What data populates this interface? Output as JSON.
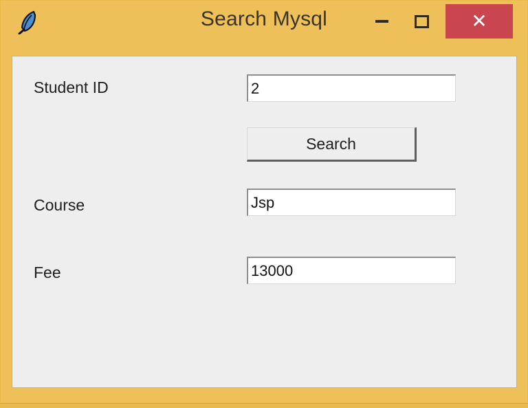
{
  "window": {
    "title": "Search Mysql",
    "icon": "feather-icon",
    "frame_color": "#edc05a",
    "client_color": "#efeeee",
    "controls": {
      "minimize_label": "–",
      "maximize_label": "□",
      "close_label": "✕",
      "close_color": "#c9464f"
    }
  },
  "form": {
    "fields": [
      {
        "label": "Student ID",
        "value": "2",
        "placeholder": ""
      },
      {
        "label": "Course",
        "value": "Jsp",
        "placeholder": ""
      },
      {
        "label": "Fee",
        "value": "13000",
        "placeholder": ""
      }
    ],
    "search_button_label": "Search"
  }
}
